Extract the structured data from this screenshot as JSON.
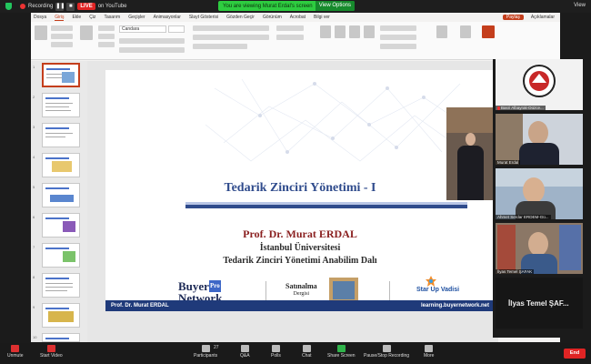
{
  "zoom_top": {
    "recording_label": "Recording",
    "live_label": "LIVE",
    "live_platform": "on YouTube",
    "viewing_banner": "You are viewing Murat Erdal's screen",
    "view_options": "View Options",
    "view_label": "View"
  },
  "ppt": {
    "menu": [
      "Dosya",
      "Giriş",
      "Ekle",
      "Çiz",
      "Tasarım",
      "Geçişler",
      "Animasyonlar",
      "Slayt Gösterisi",
      "Gözden Geçir",
      "Görünüm",
      "Acrobat",
      "Bilgi ver"
    ],
    "menu_active_index": 1,
    "share_label": "Paylaş",
    "comments_label": "Açıklamalar",
    "font_name": "Candara"
  },
  "thumbnails": {
    "numbers": [
      "1",
      "2",
      "3",
      "4",
      "5",
      "6",
      "7",
      "8",
      "9",
      "10"
    ],
    "selected_index": 0
  },
  "slide": {
    "title": "Tedarik Zinciri Yönetimi - I",
    "author": "Prof. Dr. Murat ERDAL",
    "university": "İstanbul Üniversitesi",
    "department": "Tedarik Zinciri Yönetimi Anabilim Dalı",
    "logo_buyer_line1": "Buyer",
    "logo_buyer_pro": "Pro",
    "logo_buyer_line2": "Network",
    "logo_satin": "Satınalma",
    "logo_satin_sub": "Dergisi",
    "logo_startup": "Star Up Vadisi",
    "footer_left": "Prof. Dr. Murat ERDAL",
    "footer_right": "learning.buyernetwork.net",
    "accent_color": "#2f4b8c"
  },
  "participants": [
    {
      "name": "Basri Albayrak-Düzce..."
    },
    {
      "name": "Murat Erdal"
    },
    {
      "name": "Ahmet Serdar ERDEM-Gü..."
    },
    {
      "name": "İlyas Temel ŞAFAK"
    }
  ],
  "participant_large_name": "İlyas Temel ŞAF...",
  "toolbar": {
    "unmute": "Unmute",
    "start_video": "Start Video",
    "participants": "Participants",
    "participants_count": "27",
    "qa": "Q&A",
    "polls": "Polls",
    "chat": "Chat",
    "share_screen": "Share Screen",
    "recording": "Pause/Stop Recording",
    "more": "More",
    "end": "End"
  }
}
